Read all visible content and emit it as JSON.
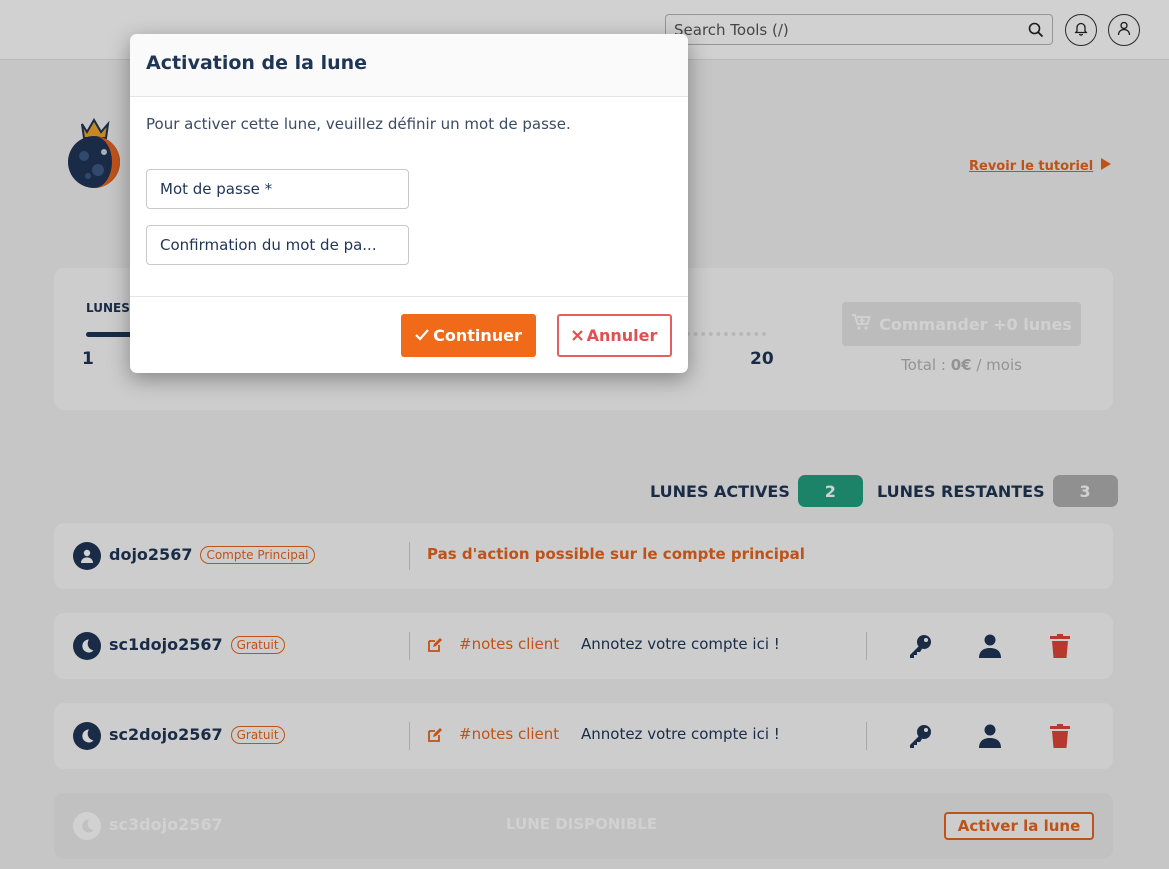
{
  "topbar": {
    "search_placeholder": "Search Tools (/)"
  },
  "page": {
    "tutorial_link": "Revoir le tutoriel",
    "panel": {
      "label": "LUNES",
      "slider_min": "1",
      "slider_max": "20",
      "order_button": "Commander +0 lunes",
      "total_prefix": "Total : ",
      "total_value": "0€",
      "total_suffix": " / mois"
    },
    "counters": {
      "active_label": "LUNES ACTIVES",
      "active_value": "2",
      "remaining_label": "LUNES RESTANTES",
      "remaining_value": "3"
    },
    "accounts": [
      {
        "name": "dojo2567",
        "tag": "Compte Principal",
        "message": "Pas d'action possible sur le compte principal"
      },
      {
        "name": "sc1dojo2567",
        "tag": "Gratuit",
        "note_tag": "#notes client",
        "note_text": "Annotez votre compte ici !"
      },
      {
        "name": "sc2dojo2567",
        "tag": "Gratuit",
        "note_tag": "#notes client",
        "note_text": "Annotez votre compte ici !"
      },
      {
        "name": "sc3dojo2567",
        "status": "LUNE DISPONIBLE",
        "action": "Activer la lune"
      }
    ]
  },
  "modal": {
    "title": "Activation de la lune",
    "description": "Pour activer cette lune, veuillez définir un mot de passe.",
    "password_placeholder": "Mot de passe *",
    "confirm_placeholder": "Confirmation du mot de pa...",
    "continue_label": "Continuer",
    "cancel_label": "Annuler"
  },
  "colors": {
    "navy": "#1f3556",
    "orange": "#e8651f",
    "green": "#23a07f",
    "gray_badge": "#b0b0b0",
    "delete_red": "#e0453a"
  }
}
